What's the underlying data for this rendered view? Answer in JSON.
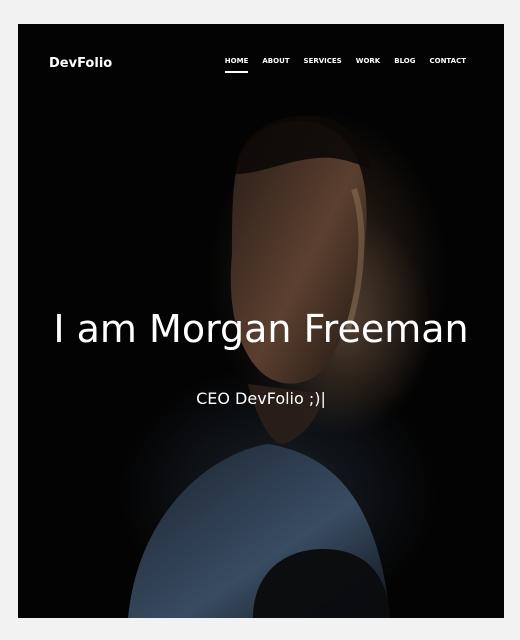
{
  "navbar": {
    "brand": "DevFolio",
    "items": [
      {
        "label": "HOME"
      },
      {
        "label": "ABOUT"
      },
      {
        "label": "SERVICES"
      },
      {
        "label": "WORK"
      },
      {
        "label": "BLOG"
      },
      {
        "label": "CONTACT"
      }
    ]
  },
  "hero": {
    "title": "I am Morgan Freeman",
    "subtitle": "CEO DevFolio ;)|"
  }
}
